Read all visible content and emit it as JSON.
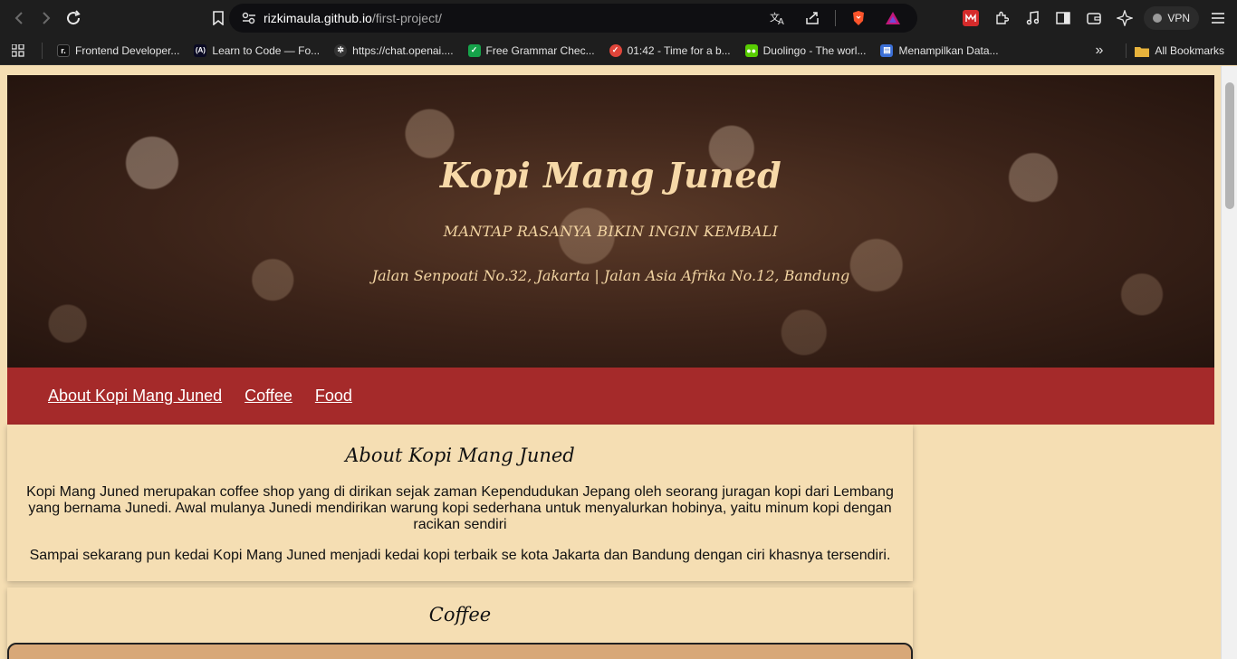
{
  "browser": {
    "url_host": "rizkimaula.github.io",
    "url_path": "/first-project/",
    "vpn_label": "VPN",
    "bookmarks": [
      {
        "label": "Frontend Developer...",
        "icon": "frontendmentor-icon",
        "color": "#111111"
      },
      {
        "label": "Learn to Code — Fo...",
        "icon": "freecodecamp-icon",
        "color": "#0a0a23"
      },
      {
        "label": "https://chat.openai....",
        "icon": "openai-icon",
        "color": "#333333"
      },
      {
        "label": "Free Grammar Chec...",
        "icon": "grammar-icon",
        "color": "#15a34a"
      },
      {
        "label": "01:42 - Time for a b...",
        "icon": "timer-icon",
        "color": "#e0453a"
      },
      {
        "label": "Duolingo - The worl...",
        "icon": "duolingo-icon",
        "color": "#58cc02"
      },
      {
        "label": "Menampilkan Data...",
        "icon": "page-icon",
        "color": "#3b6fd6"
      }
    ],
    "all_bookmarks_label": "All Bookmarks"
  },
  "hero": {
    "title": "Kopi Mang Juned",
    "tagline": "MANTAP RASANYA BIKIN INGIN KEMBALI",
    "address": "Jalan Senpoati No.32, Jakarta | Jalan Asia Afrika No.12, Bandung"
  },
  "menu": {
    "items": [
      "About Kopi Mang Juned",
      "Coffee",
      "Food"
    ]
  },
  "about": {
    "heading": "About Kopi Mang Juned",
    "paragraph1": "Kopi Mang Juned merupakan coffee shop yang di dirikan sejak zaman Kependudukan Jepang oleh seorang juragan kopi dari Lembang yang bernama Junedi. Awal mulanya Junedi mendirikan warung kopi sederhana untuk menyalurkan hobinya, yaitu minum kopi dengan racikan sendiri",
    "paragraph2": "Sampai sekarang pun kedai Kopi Mang Juned menjadi kedai kopi terbaik se kota Jakarta dan Bandung dengan ciri khasnya tersendiri."
  },
  "coffee": {
    "heading": "Coffee"
  },
  "colors": {
    "page_bg": "#f5deb3",
    "menu_bg": "#a52a2a",
    "hero_text": "#f7d9a8"
  }
}
